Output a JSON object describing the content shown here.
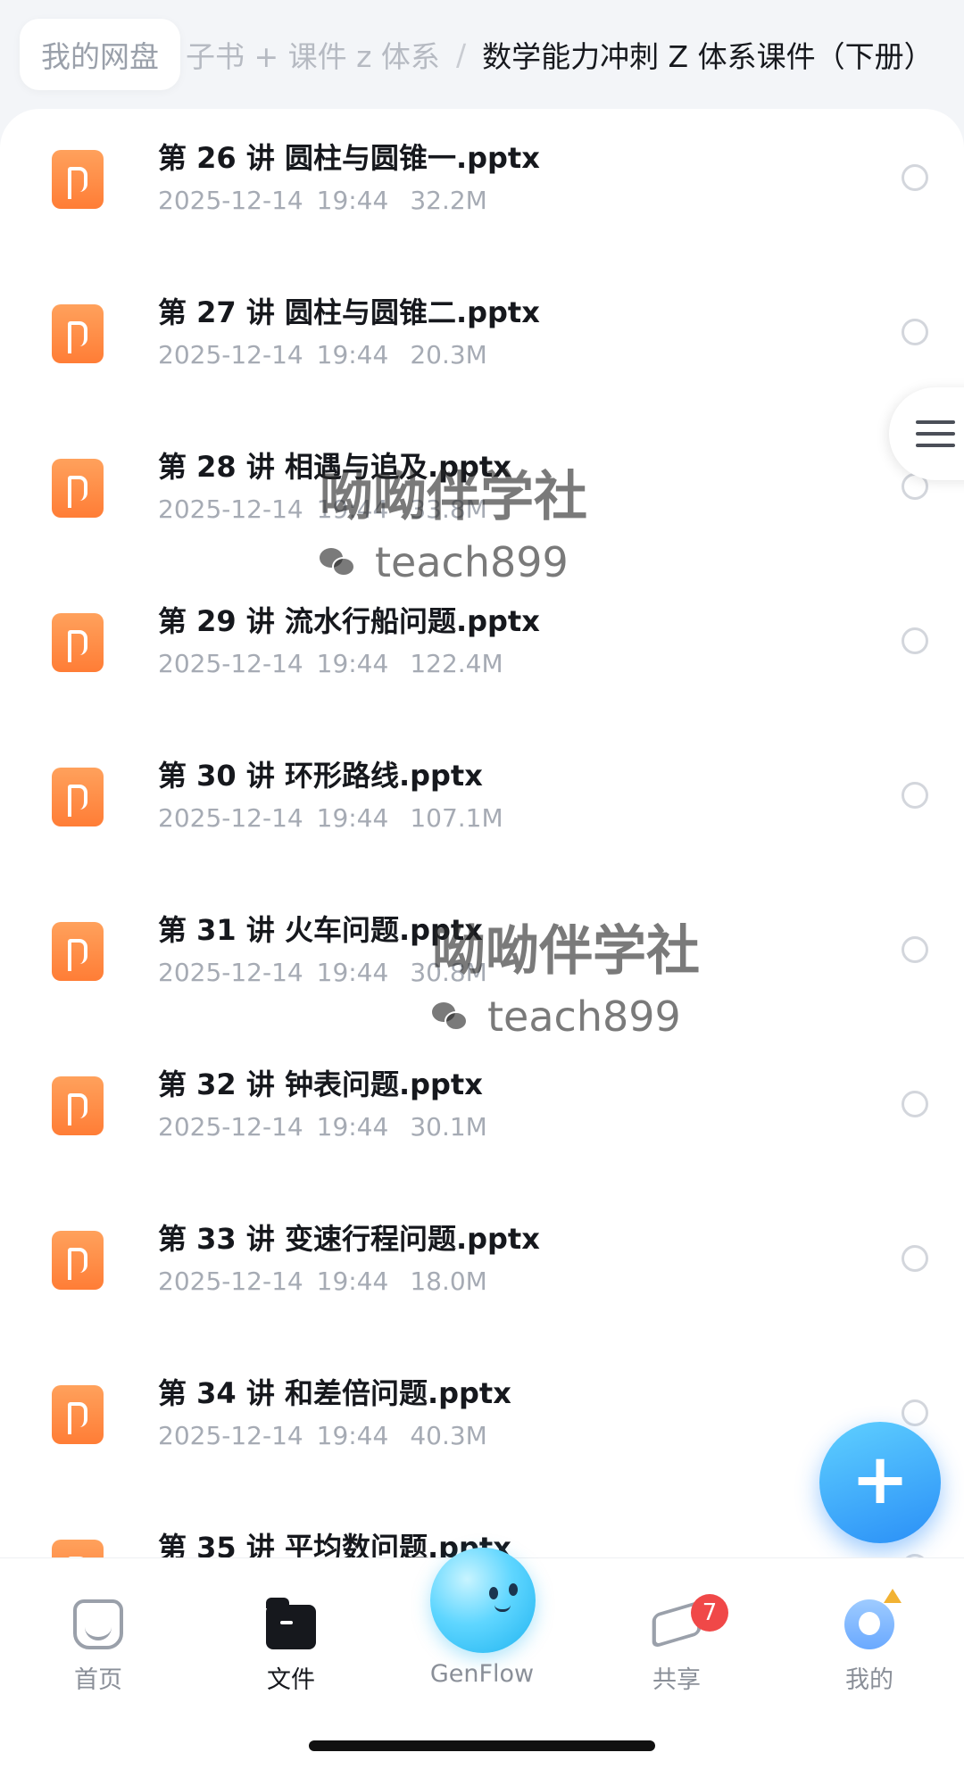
{
  "breadcrumb": {
    "root": "我的网盘",
    "middle": "子书 + 课件 z 体系",
    "separator": "/",
    "current": "数学能力冲刺 Z 体系课件（下册）"
  },
  "files": [
    {
      "name": "第 26 讲 圆柱与圆锥一.pptx",
      "date": "2025-12-14 19:44",
      "size": "32.2M"
    },
    {
      "name": "第 27 讲 圆柱与圆锥二.pptx",
      "date": "2025-12-14 19:44",
      "size": "20.3M"
    },
    {
      "name": "第 28 讲 相遇与追及.pptx",
      "date": "2025-12-14 19:44",
      "size": "33.8M"
    },
    {
      "name": "第 29 讲 流水行船问题.pptx",
      "date": "2025-12-14 19:44",
      "size": "122.4M"
    },
    {
      "name": "第 30 讲 环形路线.pptx",
      "date": "2025-12-14 19:44",
      "size": "107.1M"
    },
    {
      "name": "第 31 讲 火车问题.pptx",
      "date": "2025-12-14 19:44",
      "size": "30.8M"
    },
    {
      "name": "第 32 讲 钟表问题.pptx",
      "date": "2025-12-14 19:44",
      "size": "30.1M"
    },
    {
      "name": "第 33 讲 变速行程问题.pptx",
      "date": "2025-12-14 19:44",
      "size": "18.0M"
    },
    {
      "name": "第 34 讲 和差倍问题.pptx",
      "date": "2025-12-14 19:44",
      "size": "40.3M"
    },
    {
      "name": "第 35 讲 平均数问题.pptx",
      "date": "",
      "size": ""
    }
  ],
  "watermark": {
    "title": "呦呦伴学社",
    "wechat_id": "teach899"
  },
  "nav": {
    "home": "首页",
    "files": "文件",
    "genflow": "GenFlow",
    "share": "共享",
    "share_badge": "7",
    "me": "我的"
  },
  "icons": {
    "file_type": "pptx-icon",
    "fab": "plus-icon",
    "side_menu": "hamburger-menu-icon"
  },
  "colors": {
    "pptx_orange": "#ff8a40",
    "fab_blue": "#2a8ff7",
    "badge_red": "#f04848"
  }
}
